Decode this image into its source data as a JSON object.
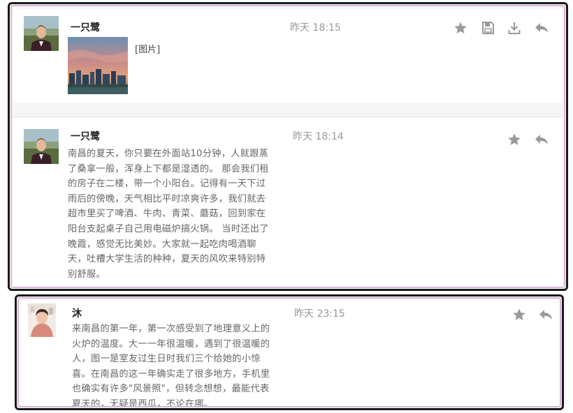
{
  "posts": [
    {
      "author": "一只鹭",
      "time": "昨天 18:15",
      "image_label": "[图片]",
      "icons": [
        "star-icon",
        "save-icon",
        "download-icon",
        "reply-icon"
      ]
    },
    {
      "author": "一只鹭",
      "time": "昨天 18:14",
      "lines": [
        "南昌的夏天，你只要在外面站10分钟，人就跟蒸",
        "了桑拿一般，浑身上下都是湿透的。 那会我们租",
        "的房子在二楼，带一个小阳台。记得有一天下过",
        "雨后的傍晚，天气相比平时凉爽许多，我们就去",
        "超市里买了啤酒、牛肉、青菜、蘑菇，回到家在",
        "阳台支起桌子自己用电磁炉搞火锅。 当时还出了",
        "晚霞，感觉无比美妙。大家就一起吃肉喝酒聊",
        "天，吐槽大学生活的种种，夏天的风吹来特别特",
        "别舒服。"
      ],
      "icons": [
        "star-icon",
        "reply-icon"
      ]
    },
    {
      "author": "沐",
      "time": "昨天 23:15",
      "lines": [
        "来南昌的第一年，第一次感受到了地理意义上的",
        "火炉的温度。大一一年很温暖，遇到了很温暖的",
        "人，图一是室友过生日时我们三个给她的小惊",
        "喜。在南昌的这一年确实走了很多地方，手机里",
        "也确实有许多\"风景照\"，但转念想想，最能代表",
        "夏天的，无疑是西瓜，不论在哪。"
      ],
      "icons": [
        "star-icon",
        "reply-icon"
      ]
    }
  ],
  "colors": {
    "panel_border": "#1a1a1a",
    "panel_inner_border": "#d9b6d6",
    "icon_gray": "#9a9a9a",
    "text_gray": "#666666",
    "time_gray": "#999999"
  }
}
